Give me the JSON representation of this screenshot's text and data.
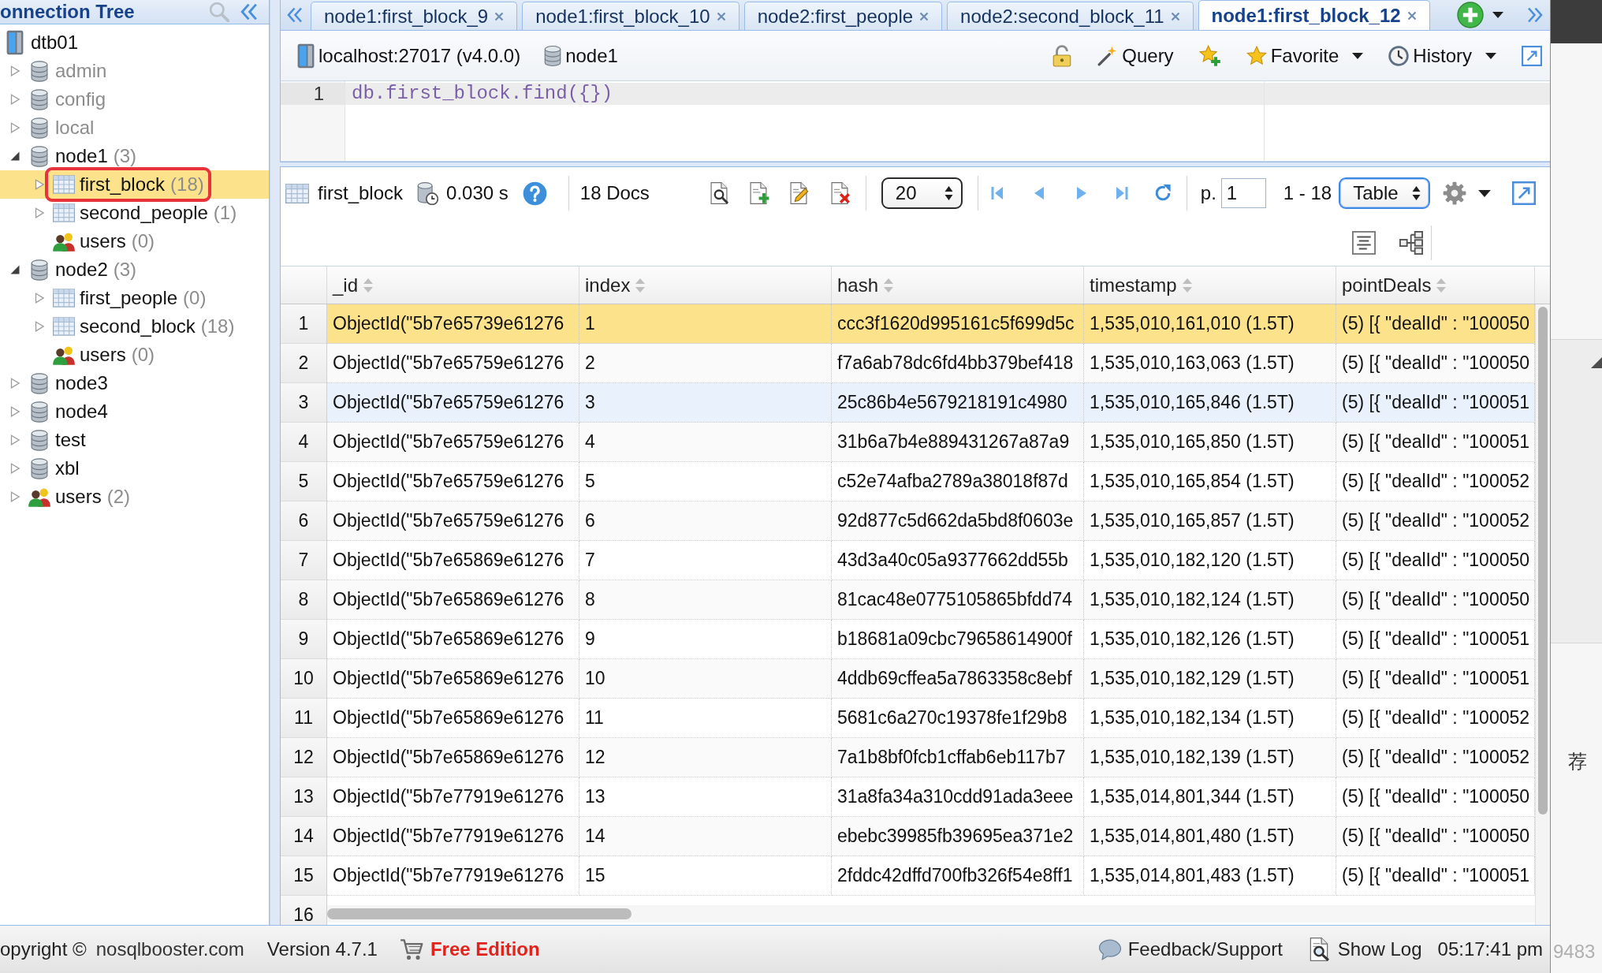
{
  "connection_tree": {
    "title": "onnection Tree",
    "items": [
      {
        "label": "dtb01",
        "kind": "server",
        "selected": false,
        "dimmed": false,
        "outlined": false,
        "children": [
          {
            "label": "admin",
            "kind": "database",
            "expanded": false,
            "selected": false,
            "dimmed": true,
            "outlined": false
          },
          {
            "label": "config",
            "kind": "database",
            "expanded": false,
            "selected": false,
            "dimmed": true,
            "outlined": false
          },
          {
            "label": "local",
            "kind": "database",
            "expanded": false,
            "selected": false,
            "dimmed": true,
            "outlined": false
          },
          {
            "label": "node1",
            "count": "(3)",
            "kind": "database",
            "expanded": true,
            "selected": false,
            "dimmed": false,
            "outlined": false,
            "children": [
              {
                "label": "first_block",
                "count": "(18)",
                "kind": "collection",
                "expanded": false,
                "selected": true,
                "dimmed": false,
                "outlined": true
              },
              {
                "label": "second_people",
                "count": "(1)",
                "kind": "collection",
                "expanded": false,
                "selected": false,
                "dimmed": false,
                "outlined": false
              },
              {
                "label": "users",
                "count": "(0)",
                "kind": "users",
                "selected": false,
                "dimmed": false,
                "outlined": false
              }
            ]
          },
          {
            "label": "node2",
            "count": "(3)",
            "kind": "database",
            "expanded": true,
            "selected": false,
            "dimmed": false,
            "outlined": false,
            "children": [
              {
                "label": "first_people",
                "count": "(0)",
                "kind": "collection",
                "expanded": false,
                "selected": false,
                "dimmed": false,
                "outlined": false
              },
              {
                "label": "second_block",
                "count": "(18)",
                "kind": "collection",
                "expanded": false,
                "selected": false,
                "dimmed": false,
                "outlined": false
              },
              {
                "label": "users",
                "count": "(0)",
                "kind": "users",
                "selected": false,
                "dimmed": false,
                "outlined": false
              }
            ]
          },
          {
            "label": "node3",
            "kind": "database",
            "expanded": false,
            "selected": false,
            "dimmed": false,
            "outlined": false
          },
          {
            "label": "node4",
            "kind": "database",
            "expanded": false,
            "selected": false,
            "dimmed": false,
            "outlined": false
          },
          {
            "label": "test",
            "kind": "database",
            "expanded": false,
            "selected": false,
            "dimmed": false,
            "outlined": false
          },
          {
            "label": "xbl",
            "kind": "database",
            "expanded": false,
            "selected": false,
            "dimmed": false,
            "outlined": false
          },
          {
            "label": "users",
            "count": "(2)",
            "kind": "users",
            "expanded": false,
            "selected": false,
            "dimmed": false,
            "outlined": false
          }
        ]
      }
    ]
  },
  "tabs": [
    {
      "label": "node1:first_block_9",
      "selected": false
    },
    {
      "label": "node1:first_block_10",
      "selected": false
    },
    {
      "label": "node2:first_people",
      "selected": false
    },
    {
      "label": "node2:second_block_11",
      "selected": false
    },
    {
      "label": "node1:first_block_12",
      "selected": true
    }
  ],
  "toolbar": {
    "server": "localhost:27017 (v4.0.0)",
    "database": "node1",
    "buttons": [
      {
        "kind": "lock",
        "dropdown": false
      },
      {
        "kind": "query",
        "label": "Query",
        "dropdown": false
      },
      {
        "kind": "add_favorite",
        "dropdown": false
      },
      {
        "kind": "favorite",
        "label": "Favorite",
        "dropdown": true
      },
      {
        "kind": "history",
        "label": "History",
        "dropdown": true
      },
      {
        "kind": "maximize",
        "dropdown": false
      }
    ]
  },
  "editor": {
    "lines": [
      {
        "number": "1",
        "code": "db.first_block.find({})",
        "active": true
      }
    ]
  },
  "results": {
    "collection": "first_block",
    "elapsed": "0.030 s",
    "count": "18 Docs",
    "page_size": "20",
    "page_label": "p.",
    "page": "1",
    "range": "1 - 18",
    "view": "Table"
  },
  "table": {
    "columns": [
      "_id",
      "index",
      "hash",
      "timestamp",
      "pointDeals"
    ],
    "rows": [
      {
        "number": "1",
        "selected": true,
        "hovered": false,
        "cells": [
          "ObjectId(\"5b7e65739e61276",
          "1",
          "ccc3f1620d995161c5f699d5c",
          "1,535,010,161,010 (1.5T)",
          "(5) [{ \"dealId\" : \"100050"
        ]
      },
      {
        "number": "2",
        "selected": false,
        "hovered": false,
        "cells": [
          "ObjectId(\"5b7e65759e61276",
          "2",
          "f7a6ab78dc6fd4bb379bef418",
          "1,535,010,163,063 (1.5T)",
          "(5) [{ \"dealId\" : \"100050"
        ]
      },
      {
        "number": "3",
        "selected": false,
        "hovered": true,
        "cells": [
          "ObjectId(\"5b7e65759e61276",
          "3",
          "25c86b4e5679218191c4980",
          "1,535,010,165,846 (1.5T)",
          "(5) [{ \"dealId\" : \"100051"
        ]
      },
      {
        "number": "4",
        "selected": false,
        "hovered": false,
        "cells": [
          "ObjectId(\"5b7e65759e61276",
          "4",
          "31b6a7b4e889431267a87a9",
          "1,535,010,165,850 (1.5T)",
          "(5) [{ \"dealId\" : \"100051"
        ]
      },
      {
        "number": "5",
        "selected": false,
        "hovered": false,
        "cells": [
          "ObjectId(\"5b7e65759e61276",
          "5",
          "c52e74afba2789a38018f87d",
          "1,535,010,165,854 (1.5T)",
          "(5) [{ \"dealId\" : \"100052"
        ]
      },
      {
        "number": "6",
        "selected": false,
        "hovered": false,
        "cells": [
          "ObjectId(\"5b7e65759e61276",
          "6",
          "92d877c5d662da5bd8f0603e",
          "1,535,010,165,857 (1.5T)",
          "(5) [{ \"dealId\" : \"100052"
        ]
      },
      {
        "number": "7",
        "selected": false,
        "hovered": false,
        "cells": [
          "ObjectId(\"5b7e65869e61276",
          "7",
          "43d3a40c05a9377662dd55b",
          "1,535,010,182,120 (1.5T)",
          "(5) [{ \"dealId\" : \"100050"
        ]
      },
      {
        "number": "8",
        "selected": false,
        "hovered": false,
        "cells": [
          "ObjectId(\"5b7e65869e61276",
          "8",
          "81cac48e0775105865bfdd74",
          "1,535,010,182,124 (1.5T)",
          "(5) [{ \"dealId\" : \"100050"
        ]
      },
      {
        "number": "9",
        "selected": false,
        "hovered": false,
        "cells": [
          "ObjectId(\"5b7e65869e61276",
          "9",
          "b18681a09cbc79658614900f",
          "1,535,010,182,126 (1.5T)",
          "(5) [{ \"dealId\" : \"100051"
        ]
      },
      {
        "number": "10",
        "selected": false,
        "hovered": false,
        "cells": [
          "ObjectId(\"5b7e65869e61276",
          "10",
          "4ddb69cffea5a7863358c8ebf",
          "1,535,010,182,129 (1.5T)",
          "(5) [{ \"dealId\" : \"100051"
        ]
      },
      {
        "number": "11",
        "selected": false,
        "hovered": false,
        "cells": [
          "ObjectId(\"5b7e65869e61276",
          "11",
          "5681c6a270c19378fe1f29b8",
          "1,535,010,182,134 (1.5T)",
          "(5) [{ \"dealId\" : \"100052"
        ]
      },
      {
        "number": "12",
        "selected": false,
        "hovered": false,
        "cells": [
          "ObjectId(\"5b7e65869e61276",
          "12",
          "7a1b8bf0fcb1cffab6eb117b7",
          "1,535,010,182,139 (1.5T)",
          "(5) [{ \"dealId\" : \"100052"
        ]
      },
      {
        "number": "13",
        "selected": false,
        "hovered": false,
        "cells": [
          "ObjectId(\"5b7e77919e61276",
          "13",
          "31a8fa34a310cdd91ada3eee",
          "1,535,014,801,344 (1.5T)",
          "(5) [{ \"dealId\" : \"100050"
        ]
      },
      {
        "number": "14",
        "selected": false,
        "hovered": false,
        "cells": [
          "ObjectId(\"5b7e77919e61276",
          "14",
          "ebebc39985fb39695ea371e2",
          "1,535,014,801,480 (1.5T)",
          "(5) [{ \"dealId\" : \"100050"
        ]
      },
      {
        "number": "15",
        "selected": false,
        "hovered": false,
        "cells": [
          "ObjectId(\"5b7e77919e61276",
          "15",
          "2fddc42dffd700fb326f54e8ff1",
          "1,535,014,801,483 (1.5T)",
          "(5) [{ \"dealId\" : \"100051"
        ]
      },
      {
        "number": "16"
      }
    ]
  },
  "status_bar": {
    "copyright": "opyright ©",
    "website": "nosqlbooster.com",
    "version": "Version 4.7.1",
    "edition": "Free Edition",
    "feedback": "Feedback/Support",
    "show_log": "Show Log",
    "clock": "05:17:41 pm"
  },
  "backdrop": {
    "side_text": "荐",
    "corner_text": "9483"
  }
}
